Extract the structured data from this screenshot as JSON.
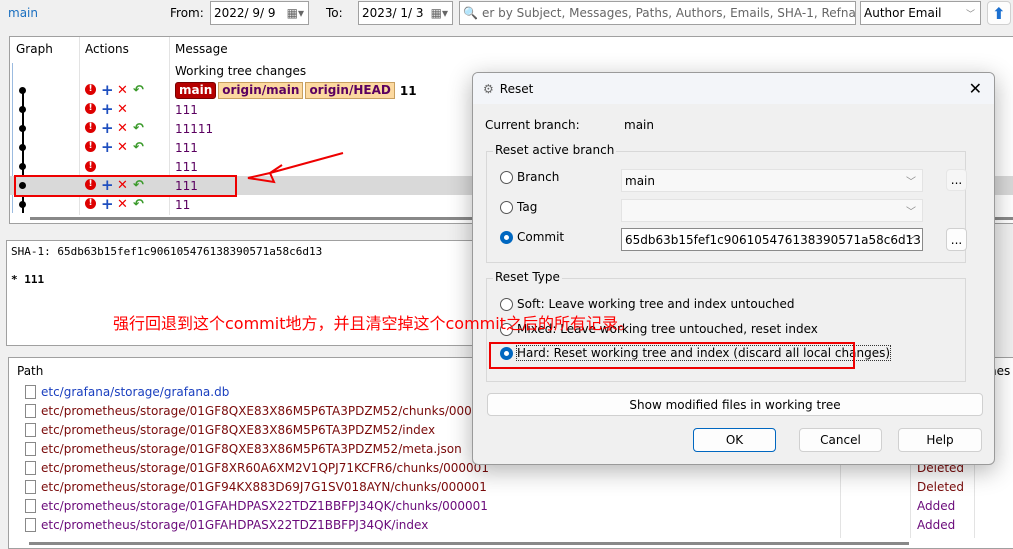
{
  "toolbar": {
    "branch": "main",
    "from_label": "From:",
    "from_date": "2022/  9/  9",
    "to_label": "To:",
    "to_date": "2023/  1/  3",
    "search_placeholder": "er by Subject, Messages, Paths, Authors, Emails, SHA-1, Refname, I",
    "filter_field": "Author Email"
  },
  "graph": {
    "columns": [
      "Graph",
      "Actions",
      "Message"
    ],
    "working_tree": "Working tree changes",
    "refs": [
      "main",
      "origin/main",
      "origin/HEAD"
    ],
    "commits": [
      {
        "message": "11",
        "actions": [
          "ex",
          "plus",
          "x",
          "back"
        ]
      },
      {
        "message": "111",
        "actions": [
          "ex",
          "plus",
          "x"
        ]
      },
      {
        "message": "11111",
        "actions": [
          "ex",
          "plus",
          "x",
          "back"
        ]
      },
      {
        "message": "111",
        "actions": [
          "ex",
          "plus",
          "x",
          "back"
        ]
      },
      {
        "message": "111",
        "actions": [
          "ex"
        ]
      },
      {
        "message": "111",
        "actions": [
          "ex",
          "plus",
          "x",
          "back"
        ],
        "selected": true
      },
      {
        "message": "11",
        "actions": [
          "ex",
          "plus",
          "x",
          "back"
        ]
      }
    ]
  },
  "commit_info": {
    "sha": "SHA-1: 65db63b15fef1c906105476138390571a58c6d13",
    "body": "* 111"
  },
  "annotation": "强行回退到这个commit地方，并且清空掉这个commit之后的所有记录。",
  "files": {
    "header": "Path",
    "lines_header": "nes",
    "rows": [
      {
        "path": "etc/grafana/storage/grafana.db",
        "status": "",
        "color": "#1a3fbf"
      },
      {
        "path": "etc/prometheus/storage/01GF8QXE83X86M5P6TA3PDZM52/chunks/000001",
        "status": "",
        "color": "#7a0a0a"
      },
      {
        "path": "etc/prometheus/storage/01GF8QXE83X86M5P6TA3PDZM52/index",
        "status": "",
        "color": "#7a0a0a"
      },
      {
        "path": "etc/prometheus/storage/01GF8QXE83X86M5P6TA3PDZM52/meta.json",
        "status": "",
        "color": "#7a0a0a"
      },
      {
        "path": "etc/prometheus/storage/01GF8XR60A6XM2V1QPJ71KCFR6/chunks/000001",
        "status": "Deleted",
        "color": "#7a0a0a"
      },
      {
        "path": "etc/prometheus/storage/01GF94KX883D69J7G1SV018AYN/chunks/000001",
        "status": "Deleted",
        "color": "#7a0a0a"
      },
      {
        "path": "etc/prometheus/storage/01GFAHDPASX22TDZ1BBFPJ34QK/chunks/000001",
        "status": "Added",
        "color": "#6a0a7a"
      },
      {
        "path": "etc/prometheus/storage/01GFAHDPASX22TDZ1BBFPJ34QK/index",
        "status": "Added",
        "color": "#6a0a7a"
      }
    ]
  },
  "dialog": {
    "title": "Reset",
    "current_branch_label": "Current branch:",
    "current_branch": "main",
    "group_branch": "Reset active branch",
    "branch_label": "Branch",
    "branch_value": "main",
    "tag_label": "Tag",
    "tag_value": "",
    "commit_label": "Commit",
    "commit_value": "65db63b15fef1c906105476138390571a58c6d13",
    "browse": "...",
    "group_type": "Reset Type",
    "soft": "Soft: Leave working tree and index untouched",
    "mixed": "Mixed: Leave working tree untouched, reset index",
    "hard": "Hard: Reset working tree and index (discard all local changes)",
    "selected_type": "hard",
    "show_modified": "Show modified files in working tree",
    "ok": "OK",
    "cancel": "Cancel",
    "help": "Help"
  },
  "colors": {
    "accent": "#0067c0",
    "annotation": "#ff0000",
    "selected_row": "#d9d9d9"
  }
}
